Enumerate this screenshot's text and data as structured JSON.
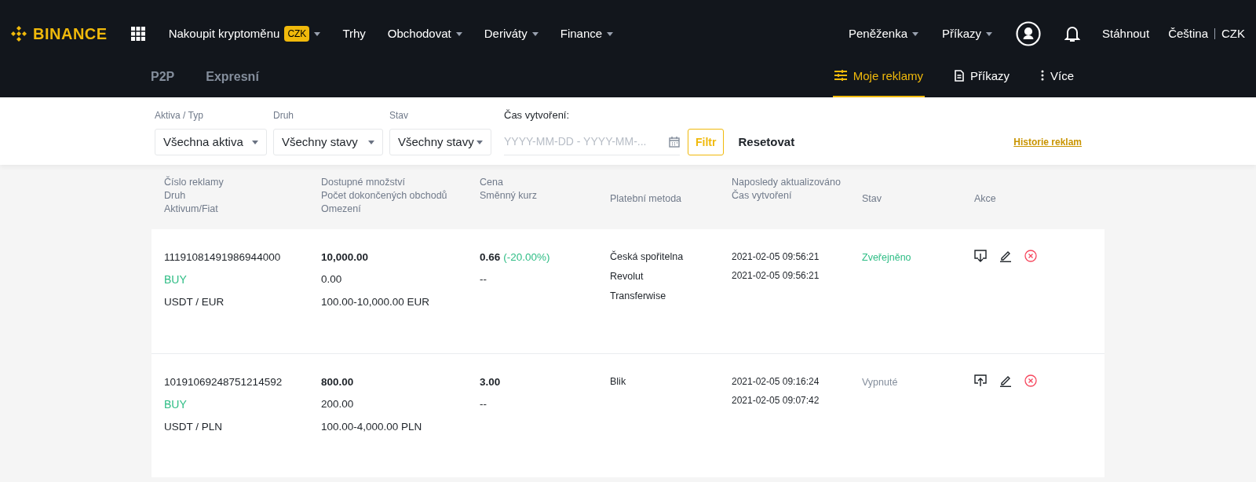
{
  "top_nav": {
    "logo": "BINANCE",
    "items": [
      {
        "label": "Nakoupit kryptoměnu",
        "badge": "CZK",
        "dropdown": true
      },
      {
        "label": "Trhy",
        "dropdown": false
      },
      {
        "label": "Obchodovat",
        "dropdown": true
      },
      {
        "label": "Deriváty",
        "dropdown": true
      },
      {
        "label": "Finance",
        "dropdown": true
      }
    ],
    "right_items": [
      {
        "label": "Peněženka",
        "dropdown": true
      },
      {
        "label": "Příkazy",
        "dropdown": true
      }
    ],
    "download": "Stáhnout",
    "language": "Čeština",
    "currency": "CZK"
  },
  "sub_nav": {
    "tabs": [
      {
        "label": "P2P",
        "selected": false
      },
      {
        "label": "Expresní",
        "selected": false
      }
    ],
    "right_tabs": [
      {
        "kind": "sliders",
        "label": "Moje reklamy",
        "selected": true
      },
      {
        "kind": "document",
        "label": "Příkazy",
        "selected": false
      },
      {
        "kind": "more",
        "label": "Více",
        "selected": false
      }
    ]
  },
  "filters": {
    "selects": [
      {
        "label": "Aktiva / Typ",
        "value": "Všechna aktiva"
      },
      {
        "label": "Druh",
        "value": "Všechny stavy"
      },
      {
        "label": "Stav",
        "value": "Všechny stavy"
      }
    ],
    "date": {
      "label": "Čas vytvoření:",
      "placeholder": "YYYY-MM-DD - YYYY-MM-..."
    },
    "filter_button": "Filtr",
    "reset_button": "Resetovat",
    "history_link": "Historie reklam"
  },
  "table": {
    "columns": [
      [
        "Číslo reklamy",
        "Druh",
        "Aktivum/Fiat"
      ],
      [
        "Dostupné množství",
        "Počet dokončených obchodů",
        "Omezení"
      ],
      [
        "Cena",
        "Směnný kurz"
      ],
      [
        "Platební metoda"
      ],
      [
        "Naposledy aktualizováno",
        "Čas vytvoření"
      ],
      [
        "Stav"
      ],
      [
        "Akce"
      ]
    ],
    "rows": [
      {
        "ad_number": "11191081491986944000",
        "side": "BUY",
        "pair": "USDT / EUR",
        "available": "10,000.00",
        "completed": "0.00",
        "limit": "100.00-10,000.00 EUR",
        "price": "0.66",
        "price_change": "(-20.00%)",
        "rate": "--",
        "payment_methods": [
          "Česká spořitelna",
          "Revolut",
          "Transferwise"
        ],
        "updated": "2021-02-05 09:56:21",
        "created": "2021-02-05 09:56:21",
        "status": "Zveřejněno",
        "published": true
      },
      {
        "ad_number": "10191069248751214592",
        "side": "BUY",
        "pair": "USDT / PLN",
        "available": "800.00",
        "completed": "200.00",
        "limit": "100.00-4,000.00 PLN",
        "price": "3.00",
        "rate": "--",
        "payment_methods": [
          "Blik"
        ],
        "updated": "2021-02-05 09:16:24",
        "created": "2021-02-05 09:07:42",
        "status": "Vypnuté",
        "published": false
      }
    ]
  }
}
